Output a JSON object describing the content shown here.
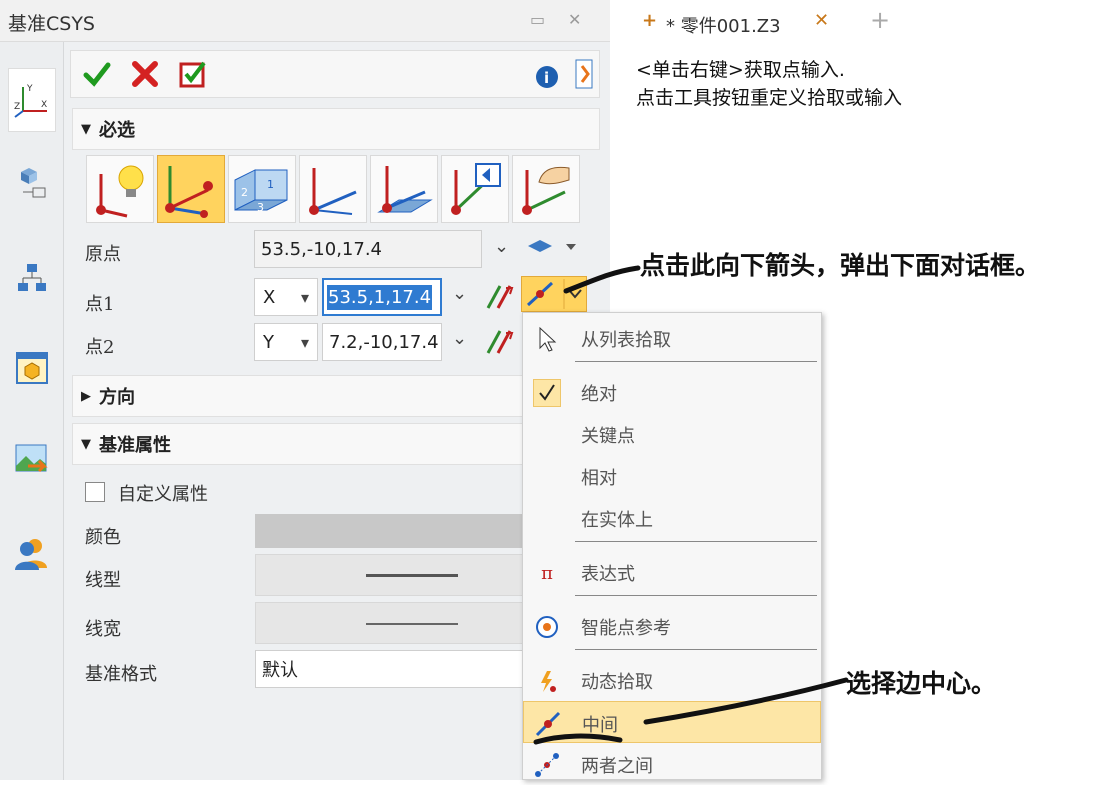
{
  "panel": {
    "title": "基准CSYS"
  },
  "tab": {
    "title": "* 零件001.Z3",
    "plus": "+",
    "close": "✕",
    "add": "+"
  },
  "prompt": {
    "line1": "<单击右键>获取点输入.",
    "line2": "点击工具按钮重定义拾取或输入"
  },
  "sections": {
    "required": "必选",
    "direction": "方向",
    "props": "基准属性"
  },
  "rows": {
    "origin": {
      "label": "原点",
      "value": "53.5,-10,17.4"
    },
    "point1": {
      "label": "点1",
      "axis": "X",
      "value": "53.5,1,17.4"
    },
    "point2": {
      "label": "点2",
      "axis": "Y",
      "value": "7.2,-10,17.4"
    }
  },
  "attrs": {
    "custom": "自定义属性",
    "color": "颜色",
    "linetype": "线型",
    "linewidth": "线宽",
    "format": "基准格式",
    "format_value": "默认"
  },
  "menu": {
    "items": [
      "从列表拾取",
      "绝对",
      "关键点",
      "相对",
      "在实体上",
      "表达式",
      "智能点参考",
      "动态拾取",
      "中间",
      "两者之间"
    ]
  },
  "annotations": {
    "a1": "点击此向下箭头，弹出下面对话框。",
    "a2": "选择边中心。"
  },
  "colors": {
    "accent": "#ffd35e",
    "highlight": "#fde6a6",
    "selection": "#2f7bd1"
  }
}
